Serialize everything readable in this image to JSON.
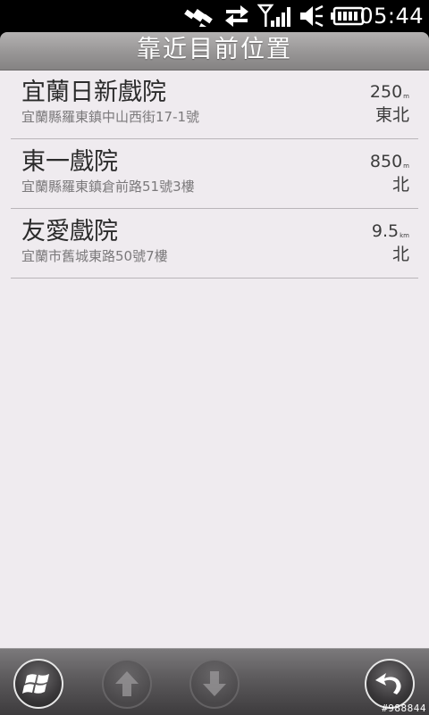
{
  "status_bar": {
    "time": "05:44",
    "icons": [
      "gps-satellite-icon",
      "data-transfer-icon",
      "signal-strength-icon",
      "speaker-muted-icon",
      "battery-icon"
    ]
  },
  "header": {
    "title": "靠近目前位置"
  },
  "places": [
    {
      "name": "宜蘭日新戲院",
      "address": "宜蘭縣羅東鎮中山西街17-1號",
      "distance": "250",
      "unit": "m",
      "direction": "東北"
    },
    {
      "name": "東一戲院",
      "address": "宜蘭縣羅東鎮倉前路51號3樓",
      "distance": "850",
      "unit": "m",
      "direction": "北"
    },
    {
      "name": "友愛戲院",
      "address": "宜蘭市舊城東路50號7樓",
      "distance": "9.5",
      "unit": "km",
      "direction": "北"
    }
  ],
  "bottom_bar": {
    "buttons": [
      "windows-start-icon",
      "scroll-up-icon",
      "scroll-down-icon",
      "back-icon"
    ]
  },
  "watermark": "#988844",
  "colors": {
    "list_background": "#efebef",
    "title_bar": "#9a9898",
    "bottom_bar": "#5c5a5c",
    "primary_text": "#2b2b2b",
    "secondary_text": "#7b797b"
  }
}
